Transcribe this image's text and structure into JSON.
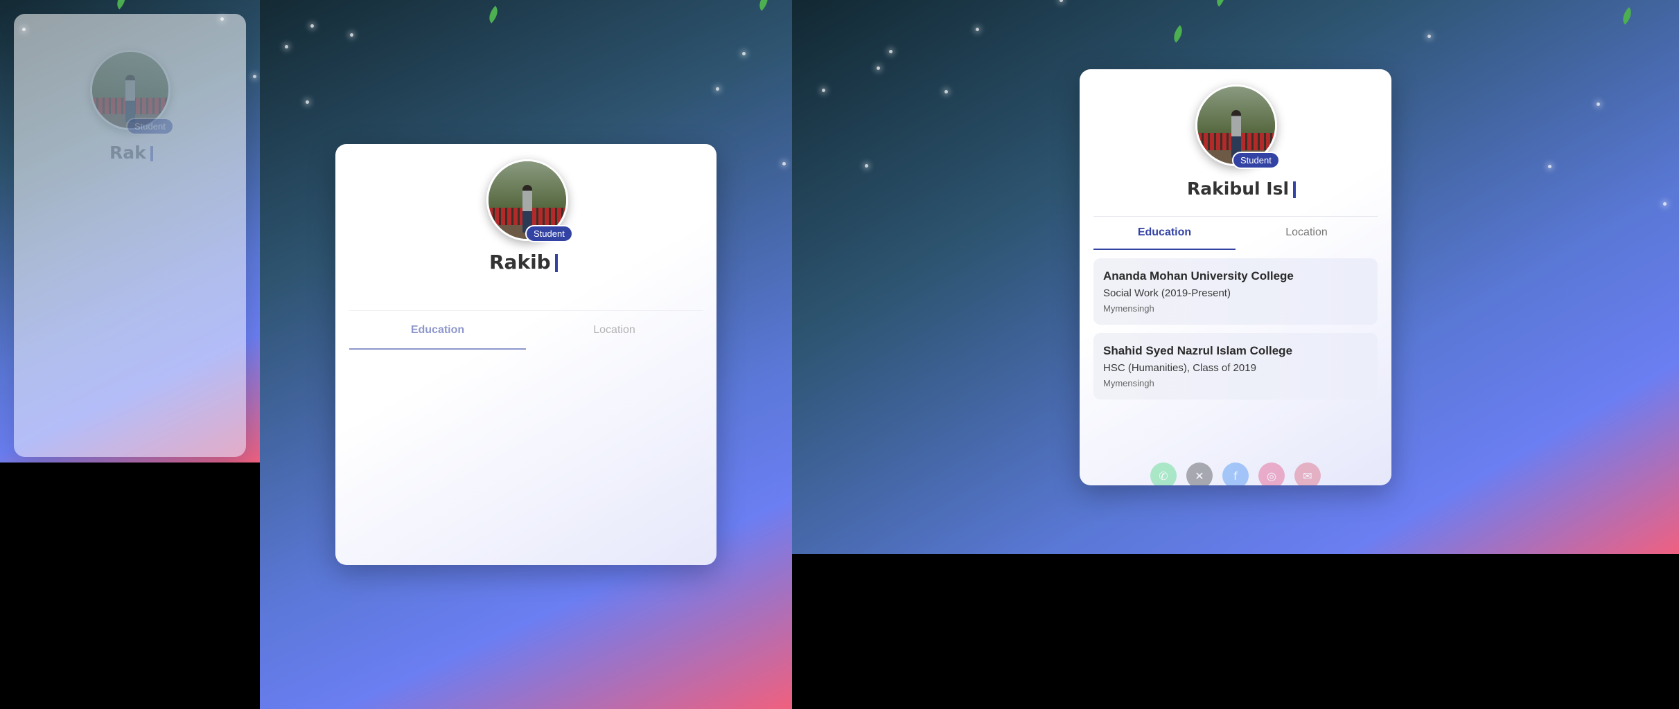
{
  "profile": {
    "role_badge": "Student",
    "typed_names": [
      "Rak",
      "Rakib",
      "Rakibul Isl"
    ]
  },
  "tabs": [
    {
      "label": "Education",
      "active": true
    },
    {
      "label": "Location",
      "active": false
    }
  ],
  "education": [
    {
      "institution": "Ananda Mohan University College",
      "detail": "Social Work (2019-Present)",
      "location": "Mymensingh"
    },
    {
      "institution": "Shahid Syed Nazrul Islam College",
      "detail": "HSC (Humanities), Class of 2019",
      "location": "Mymensingh"
    }
  ],
  "social_links": [
    {
      "icon": "whatsapp-icon",
      "color": "#25d366"
    },
    {
      "icon": "x-twitter-icon",
      "color": "#222222"
    },
    {
      "icon": "facebook-icon",
      "color": "#1877f2"
    },
    {
      "icon": "instagram-icon",
      "color": "#e1306c"
    },
    {
      "icon": "email-icon",
      "color": "#d9455f"
    }
  ],
  "colors": {
    "accent": "#3343a4",
    "gradient_start": "#142a34",
    "gradient_mid": "#6b7ef2",
    "gradient_end": "#f0607e"
  }
}
